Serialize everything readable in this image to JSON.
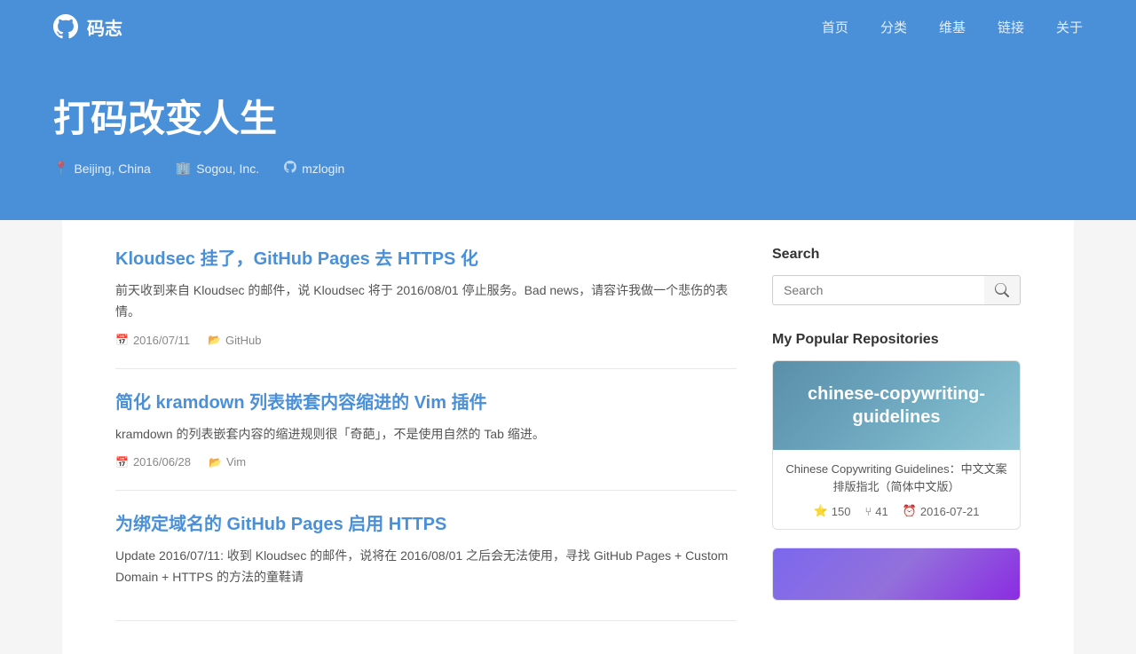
{
  "site": {
    "logo_text": "码志",
    "nav": [
      {
        "label": "首页",
        "href": "#"
      },
      {
        "label": "分类",
        "href": "#"
      },
      {
        "label": "维基",
        "href": "#"
      },
      {
        "label": "链接",
        "href": "#"
      },
      {
        "label": "关于",
        "href": "#"
      }
    ],
    "hero": {
      "title": "打码改变人生",
      "location": "Beijing, China",
      "company": "Sogou, Inc.",
      "github": "mzlogin"
    }
  },
  "search": {
    "label": "Search",
    "placeholder": "Search",
    "button_label": "search"
  },
  "sidebar": {
    "search_title": "Search",
    "repos_title": "My Popular Repositories",
    "repo1": {
      "image_text": "chinese-copywriting-guidelines",
      "description": "Chinese Copywriting Guidelines：中文文案排版指北（简体中文版）",
      "stars": "150",
      "forks": "41",
      "date": "2016-07-21"
    }
  },
  "posts": [
    {
      "title": "Kloudsec 挂了，GitHub Pages 去 HTTPS 化",
      "excerpt": "前天收到来自 Kloudsec 的邮件，说 Kloudsec 将于 2016/08/01 停止服务。Bad news，请容许我做一个悲伤的表情。",
      "date": "2016/07/11",
      "category": "GitHub"
    },
    {
      "title": "简化 kramdown 列表嵌套内容缩进的 Vim 插件",
      "excerpt": "kramdown 的列表嵌套内容的缩进规则很「奇葩」，不是使用自然的 Tab 缩进。",
      "date": "2016/06/28",
      "category": "Vim"
    },
    {
      "title": "为绑定域名的 GitHub Pages 启用 HTTPS",
      "excerpt": "Update 2016/07/11: 收到 Kloudsec 的邮件，说将在 2016/08/01 之后会无法使用，寻找 GitHub Pages + Custom Domain + HTTPS 的方法的童鞋请",
      "date": "",
      "category": ""
    }
  ]
}
